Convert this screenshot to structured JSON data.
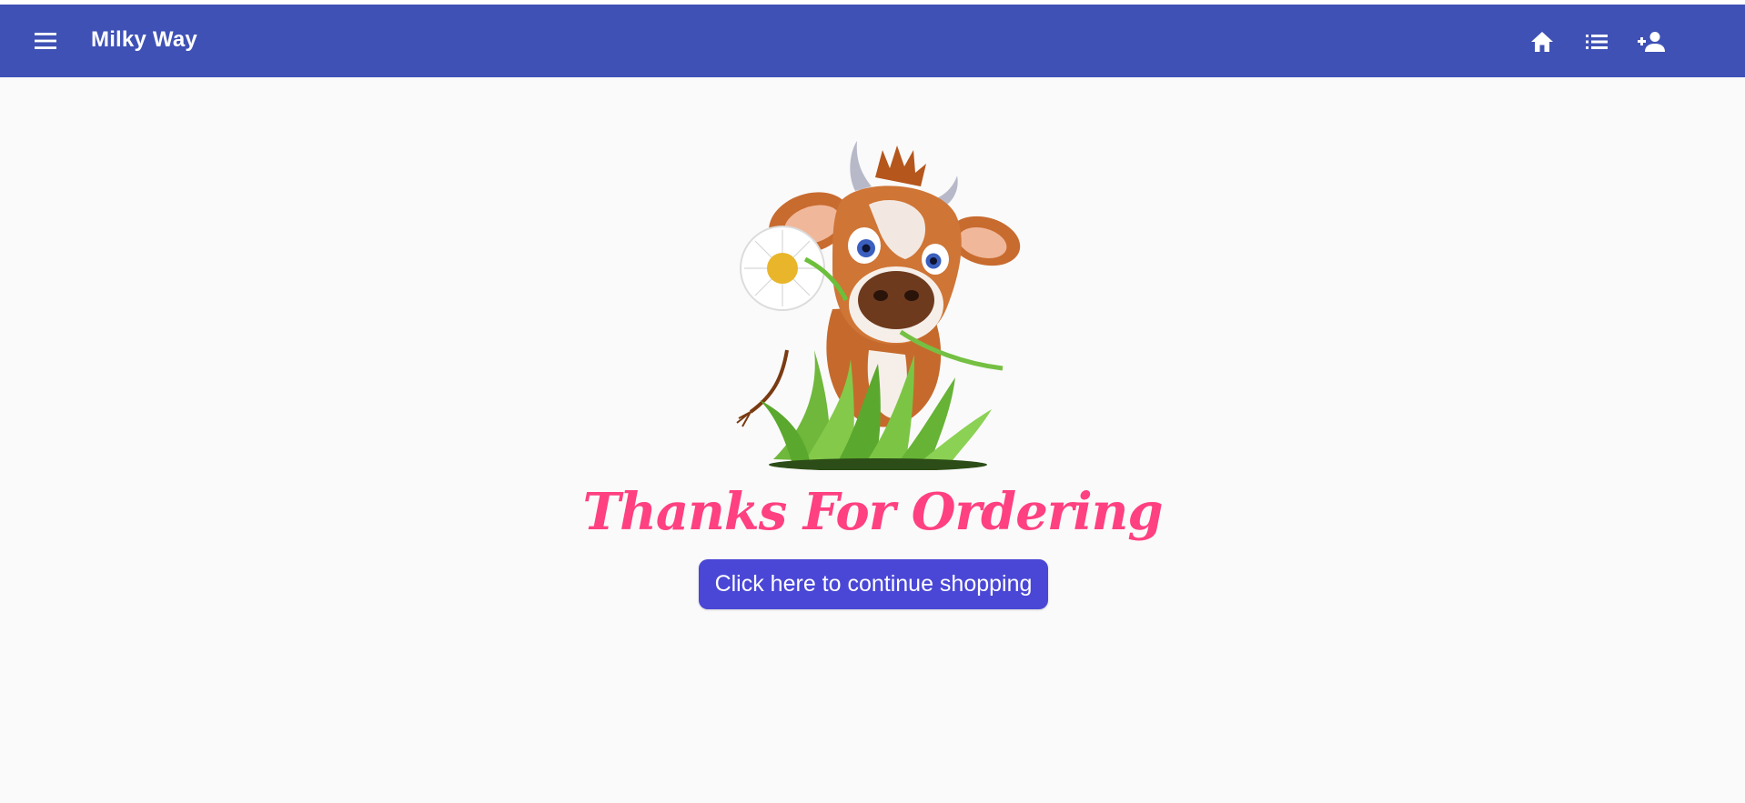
{
  "toolbar": {
    "brand": "Milky Way",
    "background": "#3f51b5",
    "icons": [
      "menu-icon",
      "home-icon",
      "list-icon",
      "person-add-icon"
    ]
  },
  "main": {
    "thanks_text": "Thanks For Ordering",
    "continue_button_label": "Click here to continue shopping",
    "illustration": "cow-with-daisy-in-grass",
    "accent_text_color": "#ff4081",
    "button_color": "#4a47d6"
  }
}
